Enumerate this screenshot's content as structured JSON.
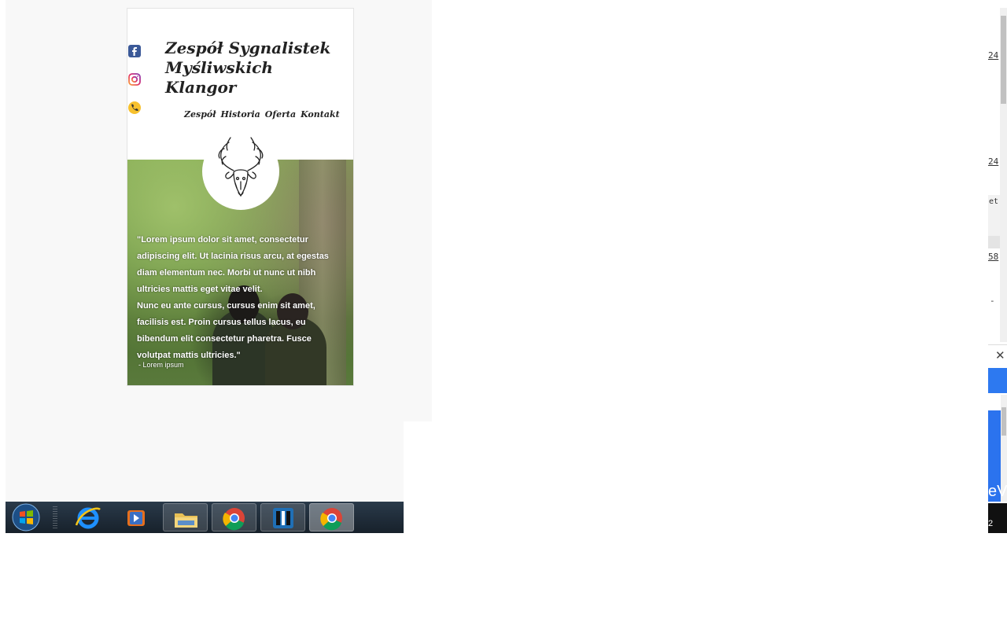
{
  "site": {
    "title": "Zespół Sygnalistek\nMyśliwskich\nKlangor",
    "nav": [
      "Zespół",
      "Historia",
      "Oferta",
      "Kontakt"
    ],
    "quote_p1": "\"Lorem ipsum dolor sit amet, consectetur adipiscing elit. Ut lacinia risus arcu, at egestas diam elementum nec. Morbi ut nunc ut nibh ultricies mattis eget vitae velit.",
    "quote_p2": "Nunc eu ante cursus, cursus enim sit amet, facilisis est. Proin cursus tellus lacus, eu bibendum elit consectetur pharetra. Fusce volutpat mattis ultricies.\"",
    "quote_author": "- Lorem ipsum",
    "social_icons": [
      "facebook-icon",
      "instagram-icon",
      "phone-icon"
    ]
  },
  "taskbar": {
    "items": [
      "start-button",
      "internet-explorer-icon",
      "media-player-icon",
      "file-explorer-icon",
      "chrome-icon",
      "app-icon",
      "chrome-icon"
    ]
  },
  "right_edge": {
    "texts": [
      "24",
      "24",
      "et",
      "58",
      "-",
      "eV",
      "2"
    ],
    "close_glyph": "✕"
  },
  "colors": {
    "taskbar": "#17212b",
    "blue_panel": "#2b73ee"
  }
}
